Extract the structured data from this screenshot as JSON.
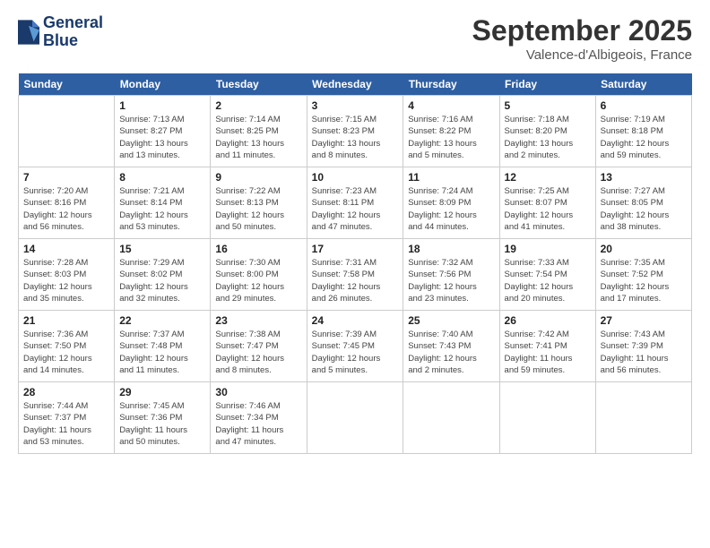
{
  "header": {
    "logo_line1": "General",
    "logo_line2": "Blue",
    "month": "September 2025",
    "location": "Valence-d'Albigeois, France"
  },
  "days_of_week": [
    "Sunday",
    "Monday",
    "Tuesday",
    "Wednesday",
    "Thursday",
    "Friday",
    "Saturday"
  ],
  "weeks": [
    [
      {
        "day": "",
        "info": ""
      },
      {
        "day": "1",
        "info": "Sunrise: 7:13 AM\nSunset: 8:27 PM\nDaylight: 13 hours\nand 13 minutes."
      },
      {
        "day": "2",
        "info": "Sunrise: 7:14 AM\nSunset: 8:25 PM\nDaylight: 13 hours\nand 11 minutes."
      },
      {
        "day": "3",
        "info": "Sunrise: 7:15 AM\nSunset: 8:23 PM\nDaylight: 13 hours\nand 8 minutes."
      },
      {
        "day": "4",
        "info": "Sunrise: 7:16 AM\nSunset: 8:22 PM\nDaylight: 13 hours\nand 5 minutes."
      },
      {
        "day": "5",
        "info": "Sunrise: 7:18 AM\nSunset: 8:20 PM\nDaylight: 13 hours\nand 2 minutes."
      },
      {
        "day": "6",
        "info": "Sunrise: 7:19 AM\nSunset: 8:18 PM\nDaylight: 12 hours\nand 59 minutes."
      }
    ],
    [
      {
        "day": "7",
        "info": "Sunrise: 7:20 AM\nSunset: 8:16 PM\nDaylight: 12 hours\nand 56 minutes."
      },
      {
        "day": "8",
        "info": "Sunrise: 7:21 AM\nSunset: 8:14 PM\nDaylight: 12 hours\nand 53 minutes."
      },
      {
        "day": "9",
        "info": "Sunrise: 7:22 AM\nSunset: 8:13 PM\nDaylight: 12 hours\nand 50 minutes."
      },
      {
        "day": "10",
        "info": "Sunrise: 7:23 AM\nSunset: 8:11 PM\nDaylight: 12 hours\nand 47 minutes."
      },
      {
        "day": "11",
        "info": "Sunrise: 7:24 AM\nSunset: 8:09 PM\nDaylight: 12 hours\nand 44 minutes."
      },
      {
        "day": "12",
        "info": "Sunrise: 7:25 AM\nSunset: 8:07 PM\nDaylight: 12 hours\nand 41 minutes."
      },
      {
        "day": "13",
        "info": "Sunrise: 7:27 AM\nSunset: 8:05 PM\nDaylight: 12 hours\nand 38 minutes."
      }
    ],
    [
      {
        "day": "14",
        "info": "Sunrise: 7:28 AM\nSunset: 8:03 PM\nDaylight: 12 hours\nand 35 minutes."
      },
      {
        "day": "15",
        "info": "Sunrise: 7:29 AM\nSunset: 8:02 PM\nDaylight: 12 hours\nand 32 minutes."
      },
      {
        "day": "16",
        "info": "Sunrise: 7:30 AM\nSunset: 8:00 PM\nDaylight: 12 hours\nand 29 minutes."
      },
      {
        "day": "17",
        "info": "Sunrise: 7:31 AM\nSunset: 7:58 PM\nDaylight: 12 hours\nand 26 minutes."
      },
      {
        "day": "18",
        "info": "Sunrise: 7:32 AM\nSunset: 7:56 PM\nDaylight: 12 hours\nand 23 minutes."
      },
      {
        "day": "19",
        "info": "Sunrise: 7:33 AM\nSunset: 7:54 PM\nDaylight: 12 hours\nand 20 minutes."
      },
      {
        "day": "20",
        "info": "Sunrise: 7:35 AM\nSunset: 7:52 PM\nDaylight: 12 hours\nand 17 minutes."
      }
    ],
    [
      {
        "day": "21",
        "info": "Sunrise: 7:36 AM\nSunset: 7:50 PM\nDaylight: 12 hours\nand 14 minutes."
      },
      {
        "day": "22",
        "info": "Sunrise: 7:37 AM\nSunset: 7:48 PM\nDaylight: 12 hours\nand 11 minutes."
      },
      {
        "day": "23",
        "info": "Sunrise: 7:38 AM\nSunset: 7:47 PM\nDaylight: 12 hours\nand 8 minutes."
      },
      {
        "day": "24",
        "info": "Sunrise: 7:39 AM\nSunset: 7:45 PM\nDaylight: 12 hours\nand 5 minutes."
      },
      {
        "day": "25",
        "info": "Sunrise: 7:40 AM\nSunset: 7:43 PM\nDaylight: 12 hours\nand 2 minutes."
      },
      {
        "day": "26",
        "info": "Sunrise: 7:42 AM\nSunset: 7:41 PM\nDaylight: 11 hours\nand 59 minutes."
      },
      {
        "day": "27",
        "info": "Sunrise: 7:43 AM\nSunset: 7:39 PM\nDaylight: 11 hours\nand 56 minutes."
      }
    ],
    [
      {
        "day": "28",
        "info": "Sunrise: 7:44 AM\nSunset: 7:37 PM\nDaylight: 11 hours\nand 53 minutes."
      },
      {
        "day": "29",
        "info": "Sunrise: 7:45 AM\nSunset: 7:36 PM\nDaylight: 11 hours\nand 50 minutes."
      },
      {
        "day": "30",
        "info": "Sunrise: 7:46 AM\nSunset: 7:34 PM\nDaylight: 11 hours\nand 47 minutes."
      },
      {
        "day": "",
        "info": ""
      },
      {
        "day": "",
        "info": ""
      },
      {
        "day": "",
        "info": ""
      },
      {
        "day": "",
        "info": ""
      }
    ]
  ]
}
